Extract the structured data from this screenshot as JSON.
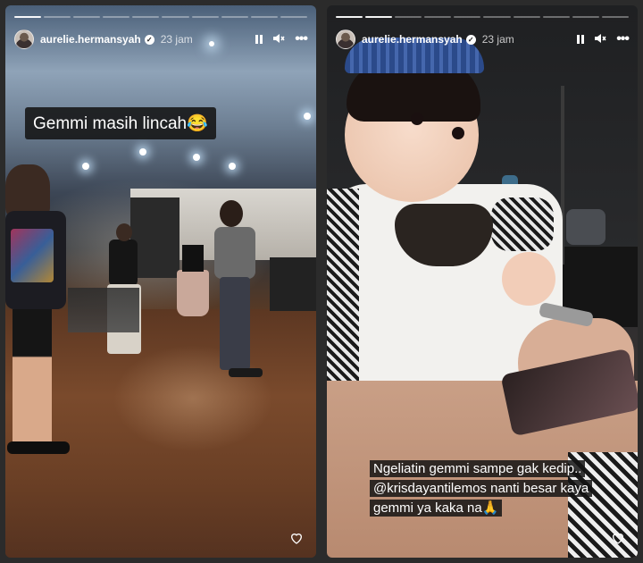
{
  "stories": [
    {
      "username": "aurelie.hermansyah",
      "time": "23 jam",
      "caption": "Gemmi masih lincah😂",
      "progress_total": 10,
      "progress_done": 1
    },
    {
      "username": "aurelie.hermansyah",
      "time": "23 jam",
      "caption": "Ngeliatin gemmi sampe gak kedip.. @krisdayantilemos nanti besar kaya gemmi ya kaka na🙏",
      "progress_total": 10,
      "progress_done": 2
    }
  ],
  "icons": {
    "verified": "verified-badge-icon",
    "pause": "pause-icon",
    "mute": "muted-speaker-icon",
    "more": "more-options-icon",
    "like": "heart-icon"
  }
}
